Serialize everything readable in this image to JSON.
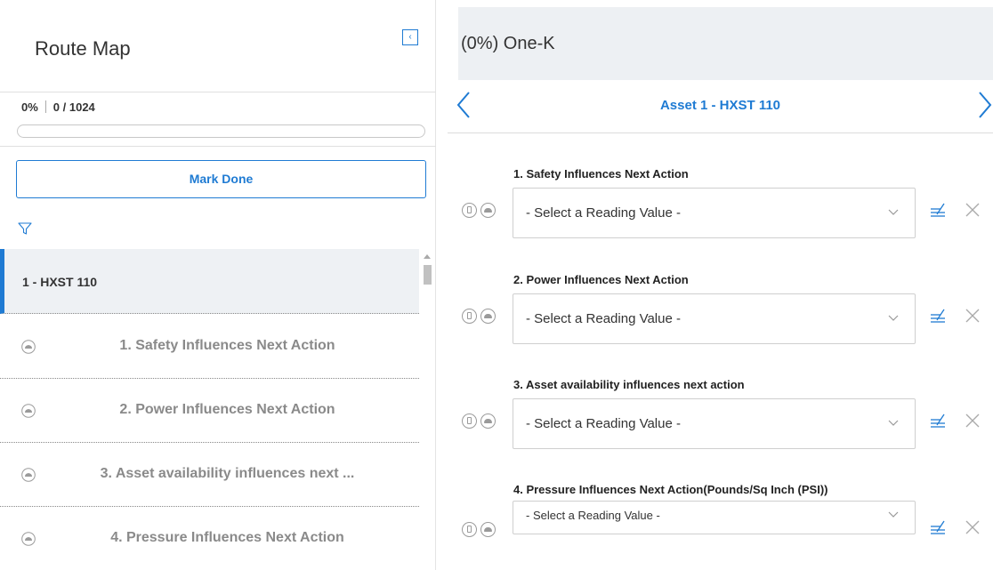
{
  "left_panel": {
    "title": "Route Map",
    "collapse_icon": "chevron-left-icon",
    "progress": {
      "percent_text": "0%",
      "count_text": "0 / 1024",
      "fraction": 0
    },
    "mark_done_label": "Mark Done",
    "filter_icon": "filter-icon",
    "asset_item": {
      "label": "1 - HXST 110"
    },
    "steps": [
      {
        "label": "1. Safety Influences Next Action"
      },
      {
        "label": "2. Power Influences Next Action"
      },
      {
        "label": "3. Asset availability influences next ..."
      },
      {
        "label": "4. Pressure Influences Next Action"
      }
    ]
  },
  "right_panel": {
    "title": "(0%) One-K",
    "asset_nav": {
      "title": "Asset 1 - HXST 110",
      "prev_icon": "chevron-left-icon",
      "next_icon": "chevron-right-icon"
    },
    "readings": [
      {
        "label": "1. Safety Influences Next Action",
        "placeholder": "- Select a Reading Value -"
      },
      {
        "label": "2. Power Influences Next Action",
        "placeholder": "- Select a Reading Value -"
      },
      {
        "label": "3. Asset availability influences next action",
        "placeholder": "- Select a Reading Value -"
      },
      {
        "label": "4. Pressure Influences Next Action(Pounds/Sq Inch (PSI))",
        "placeholder": "- Select a Reading Value -"
      }
    ]
  },
  "colors": {
    "accent": "#1f7bd3",
    "header_bg": "#edf0f3",
    "muted_text": "#8a8a8a"
  }
}
